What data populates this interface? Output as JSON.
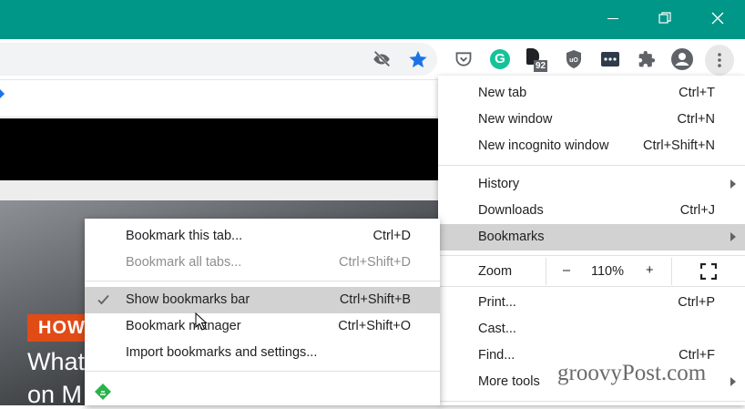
{
  "window": {
    "minimize": "—",
    "maximize": "❐",
    "close": "✕"
  },
  "toolbar": {
    "extensions": [
      {
        "icon": "eye-off-icon"
      },
      {
        "icon": "star-icon"
      },
      {
        "icon": "pocket-icon"
      },
      {
        "icon": "grammarly-icon",
        "glyph": "G"
      },
      {
        "icon": "extension-badge-icon",
        "badge": "92"
      },
      {
        "icon": "ublock-icon",
        "glyph": "uO"
      },
      {
        "icon": "password-manager-icon"
      },
      {
        "icon": "puzzle-icon"
      },
      {
        "icon": "profile-icon"
      },
      {
        "icon": "kebab-menu-icon"
      }
    ]
  },
  "page": {
    "badge": "HOW",
    "headline_1": "What",
    "headline_2": "on M"
  },
  "menu": {
    "new_tab": {
      "label": "New tab",
      "shortcut": "Ctrl+T"
    },
    "new_window": {
      "label": "New window",
      "shortcut": "Ctrl+N"
    },
    "new_incognito": {
      "label": "New incognito window",
      "shortcut": "Ctrl+Shift+N"
    },
    "history": {
      "label": "History"
    },
    "downloads": {
      "label": "Downloads",
      "shortcut": "Ctrl+J"
    },
    "bookmarks": {
      "label": "Bookmarks"
    },
    "zoom": {
      "label": "Zoom",
      "minus": "–",
      "value": "110%",
      "plus": "+"
    },
    "print": {
      "label": "Print...",
      "shortcut": "Ctrl+P"
    },
    "cast": {
      "label": "Cast..."
    },
    "find": {
      "label": "Find...",
      "shortcut": "Ctrl+F"
    },
    "more_tools": {
      "label": "More tools"
    }
  },
  "submenu": {
    "bookmark_tab": {
      "label": "Bookmark this tab...",
      "shortcut": "Ctrl+D"
    },
    "bookmark_all": {
      "label": "Bookmark all tabs...",
      "shortcut": "Ctrl+Shift+D"
    },
    "show_bar": {
      "label": "Show bookmarks bar",
      "shortcut": "Ctrl+Shift+B",
      "checked": true
    },
    "manager": {
      "label": "Bookmark manager",
      "shortcut": "Ctrl+Shift+O"
    },
    "import": {
      "label": "Import bookmarks and settings..."
    }
  },
  "watermark": "groovyPost.com",
  "colors": {
    "titlebar": "#009688",
    "highlight": "#d2d2d2",
    "star": "#1a73e8",
    "badge": "#e14b16"
  }
}
